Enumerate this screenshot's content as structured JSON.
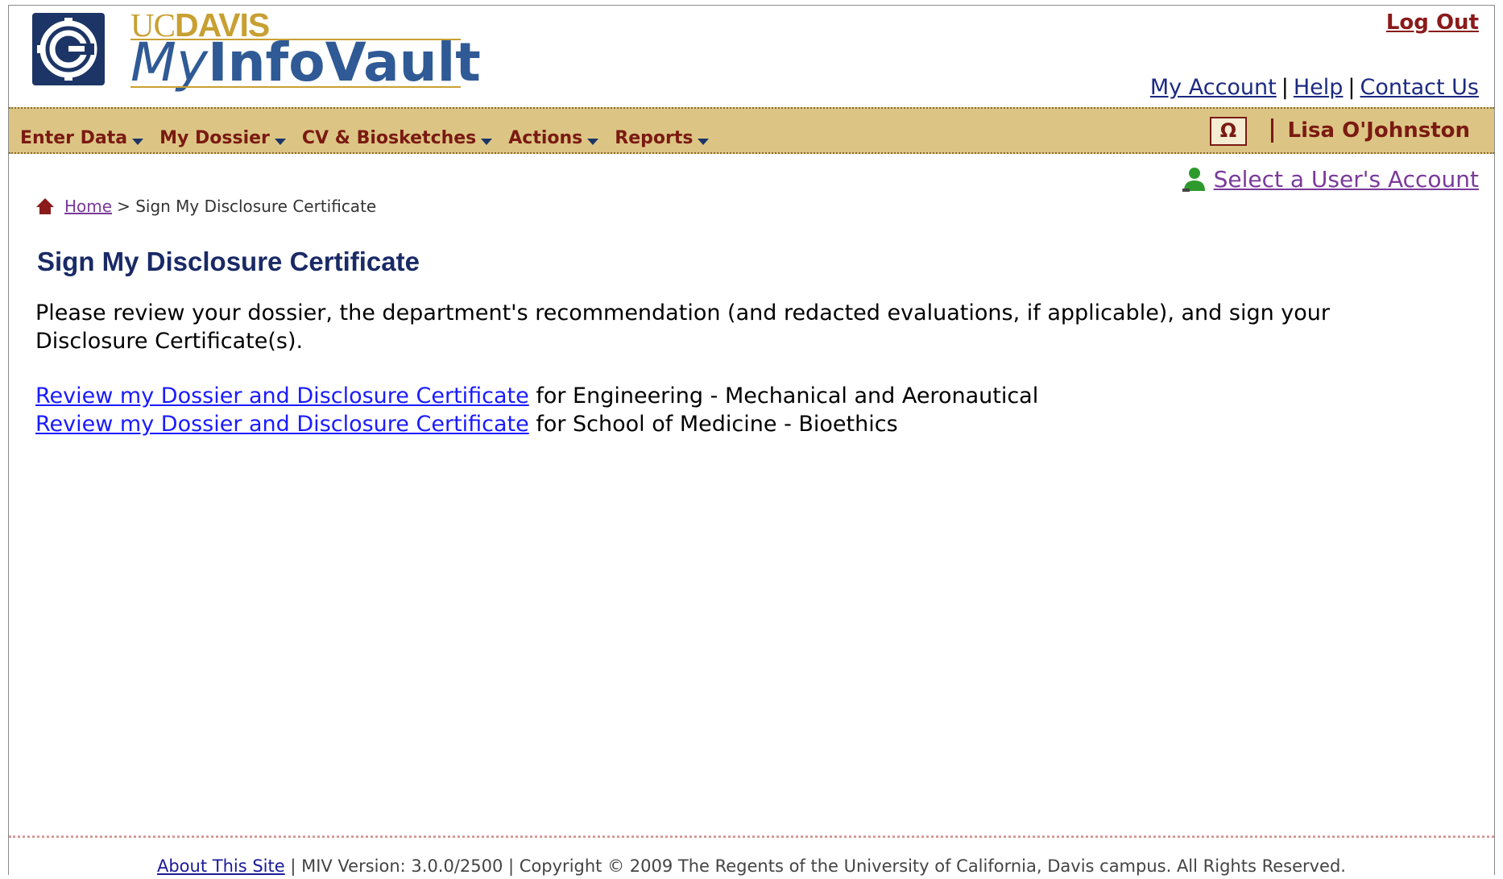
{
  "brand": {
    "uc": "UC",
    "davis": "DAVIS",
    "my": "My",
    "infovault": "InfoVault"
  },
  "header": {
    "logout": "Log Out",
    "links": [
      "My Account",
      "Help",
      "Contact Us"
    ],
    "separator": "|"
  },
  "nav": {
    "items": [
      "Enter Data",
      "My Dossier",
      "CV & Biosketches",
      "Actions",
      "Reports"
    ],
    "omega": "Ω",
    "user_name": "Lisa O'Johnston"
  },
  "select_user": "Select a User's Account",
  "breadcrumb": {
    "home": "Home",
    "separator": ">",
    "current": "Sign My Disclosure Certificate"
  },
  "page_title": "Sign My Disclosure Certificate",
  "intro": "Please review your dossier, the department's recommendation (and redacted evaluations, if applicable), and sign your Disclosure Certificate(s).",
  "review_links": [
    {
      "link": "Review my Dossier and Disclosure Certificate",
      "suffix": " for Engineering - Mechanical and Aeronautical"
    },
    {
      "link": "Review my Dossier and Disclosure Certificate",
      "suffix": " for School of Medicine - Bioethics"
    }
  ],
  "footer": {
    "about": "About This Site",
    "version": " | MIV Version: 3.0.0/2500 | Copyright © 2009 The Regents of the University of California, Davis campus. All Rights Reserved."
  },
  "colors": {
    "navbar": "#dcc584",
    "nav_text": "#7a1a12",
    "title": "#1a2a66",
    "link": "#1a1aff",
    "brand_gold": "#c8a032",
    "brand_blue": "#2f5a96"
  }
}
